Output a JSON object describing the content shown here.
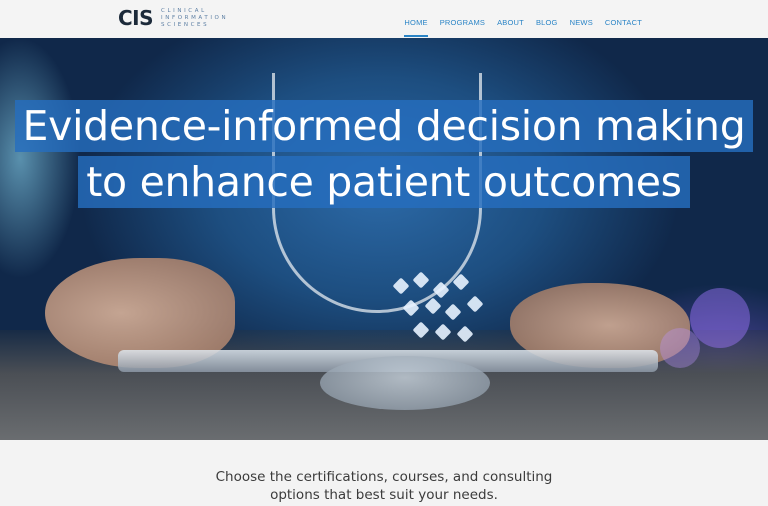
{
  "brand": {
    "mark": "CIS",
    "name_lines": [
      "CLINICAL",
      "INFORMATION",
      "SCIENCES"
    ]
  },
  "nav": {
    "items": [
      "HOME",
      "PROGRAMS",
      "ABOUT",
      "BLOG",
      "NEWS",
      "CONTACT"
    ],
    "active": "HOME"
  },
  "hero": {
    "headline_line1": "Evidence-informed decision making",
    "headline_line2": "to enhance patient outcomes"
  },
  "tagline": {
    "line1": "Choose the certifications, courses, and consulting",
    "line2": "options that best suit your needs."
  },
  "colors": {
    "accent": "#2a84c6",
    "headline_bg": "#266ebe",
    "logo": "#1c2a3a"
  }
}
